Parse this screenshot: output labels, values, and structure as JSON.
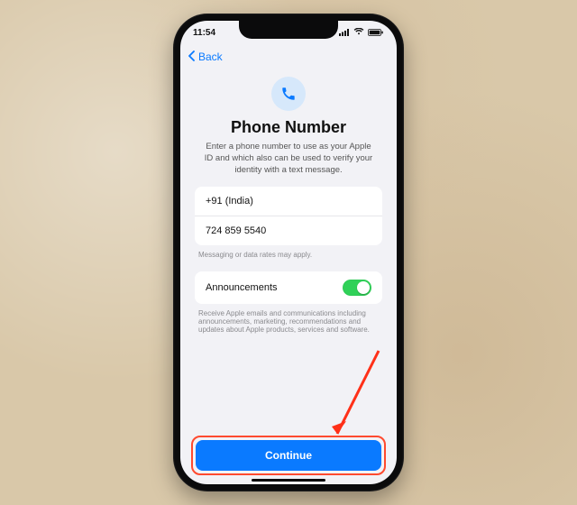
{
  "status": {
    "time": "11:54"
  },
  "nav": {
    "back_label": "Back"
  },
  "header": {
    "title": "Phone Number",
    "subtitle": "Enter a phone number to use as your Apple ID and which also can be used to verify your identity with a text message."
  },
  "form": {
    "country_code": "+91 (India)",
    "phone_number": "724 859 5540",
    "rates_note": "Messaging or data rates may apply."
  },
  "announcements": {
    "label": "Announcements",
    "enabled": true,
    "description": "Receive Apple emails and communications including announcements, marketing, recommendations and updates about Apple products, services and software."
  },
  "cta": {
    "continue_label": "Continue"
  },
  "annotation": {
    "highlight_color": "#ff4a2f"
  }
}
